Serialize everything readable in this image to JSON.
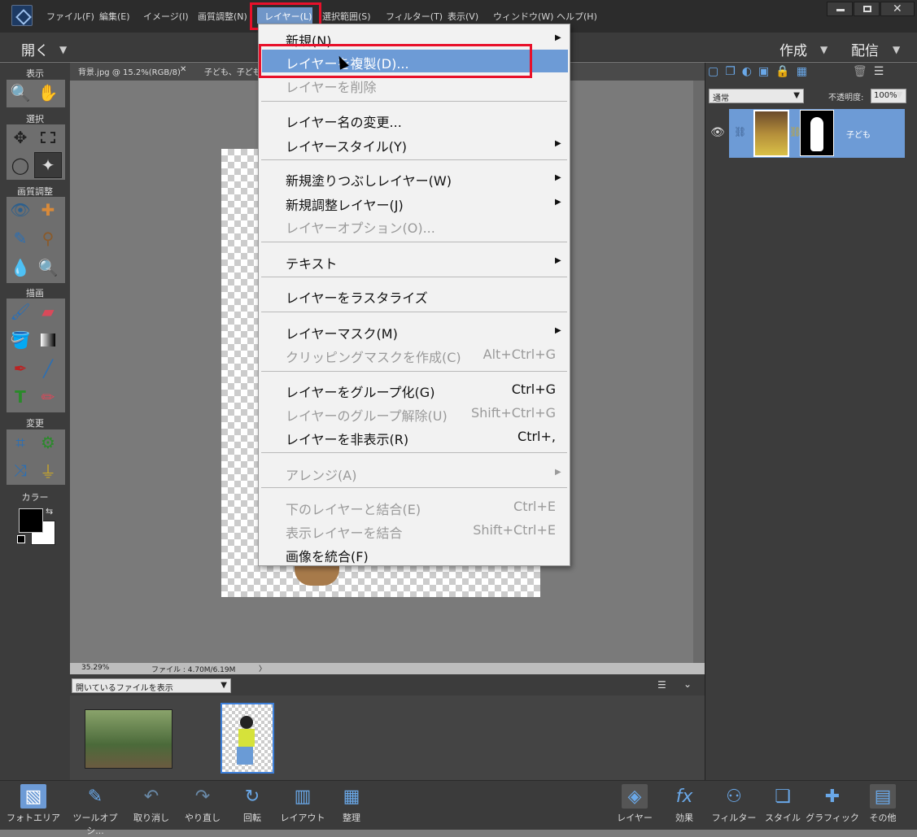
{
  "menubar": {
    "items": [
      "ファイル(F)",
      "編集(E)",
      "イメージ(I)",
      "画質調整(N)",
      "レイヤー(L)",
      "選択範囲(S)",
      "フィルター(T)",
      "表示(V)",
      "ウィンドウ(W)",
      "ヘルプ(H)"
    ],
    "active": "レイヤー(L)"
  },
  "topbar": {
    "open_label": "開く",
    "create_label": "作成",
    "share_label": "配信"
  },
  "toolpanel": {
    "sections": [
      "表示",
      "選択",
      "画質調整",
      "描画",
      "変更",
      "カラー"
    ]
  },
  "doctabs": {
    "tab1": "背景.jpg @ 15.2%(RGB/8)",
    "tab2": "子ども、子どもレ"
  },
  "status": {
    "zoom": "35.29%",
    "file": "ファイル : 4.70M/6.19M"
  },
  "bin": {
    "filter": "開いているファイルを表示"
  },
  "layers": {
    "blend_mode": "通常",
    "opacity_label": "不透明度:",
    "opacity_value": "100%",
    "layer_name": "子ども"
  },
  "dropdown": {
    "items": [
      {
        "label": "新規(N)",
        "shortcut": "",
        "disabled": false,
        "submenu": true
      },
      {
        "label": "レイヤーを複製(D)...",
        "shortcut": "",
        "disabled": false,
        "submenu": false,
        "highlighted": true
      },
      {
        "label": "レイヤーを削除",
        "shortcut": "",
        "disabled": true,
        "submenu": false
      },
      {
        "label": "レイヤー名の変更...",
        "shortcut": "",
        "disabled": false,
        "submenu": false
      },
      {
        "label": "レイヤースタイル(Y)",
        "shortcut": "",
        "disabled": false,
        "submenu": true
      },
      {
        "label": "新規塗りつぶしレイヤー(W)",
        "shortcut": "",
        "disabled": false,
        "submenu": true
      },
      {
        "label": "新規調整レイヤー(J)",
        "shortcut": "",
        "disabled": false,
        "submenu": true
      },
      {
        "label": "レイヤーオプション(O)...",
        "shortcut": "",
        "disabled": true,
        "submenu": false
      },
      {
        "label": "テキスト",
        "shortcut": "",
        "disabled": false,
        "submenu": true
      },
      {
        "label": "レイヤーをラスタライズ",
        "shortcut": "",
        "disabled": false,
        "submenu": false
      },
      {
        "label": "レイヤーマスク(M)",
        "shortcut": "",
        "disabled": false,
        "submenu": true
      },
      {
        "label": "クリッピングマスクを作成(C)",
        "shortcut": "Alt+Ctrl+G",
        "disabled": true,
        "submenu": false
      },
      {
        "label": "レイヤーをグループ化(G)",
        "shortcut": "Ctrl+G",
        "disabled": false,
        "submenu": false
      },
      {
        "label": "レイヤーのグループ解除(U)",
        "shortcut": "Shift+Ctrl+G",
        "disabled": true,
        "submenu": false
      },
      {
        "label": "レイヤーを非表示(R)",
        "shortcut": "Ctrl+,",
        "disabled": false,
        "submenu": false
      },
      {
        "label": "アレンジ(A)",
        "shortcut": "",
        "disabled": true,
        "submenu": true
      },
      {
        "label": "下のレイヤーと結合(E)",
        "shortcut": "Ctrl+E",
        "disabled": true,
        "submenu": false
      },
      {
        "label": "表示レイヤーを結合",
        "shortcut": "Shift+Ctrl+E",
        "disabled": true,
        "submenu": false
      },
      {
        "label": "画像を統合(F)",
        "shortcut": "",
        "disabled": false,
        "submenu": false
      }
    ]
  },
  "bottombar": {
    "items": [
      "フォトエリア",
      "ツールオプシ...",
      "取り消し",
      "やり直し",
      "回転",
      "レイアウト",
      "整理",
      "レイヤー",
      "効果",
      "フィルター",
      "スタイル",
      "グラフィック",
      "その他"
    ]
  },
  "colors": {
    "accent": "#6d9bd6",
    "highlight_box": "#e8102a"
  }
}
